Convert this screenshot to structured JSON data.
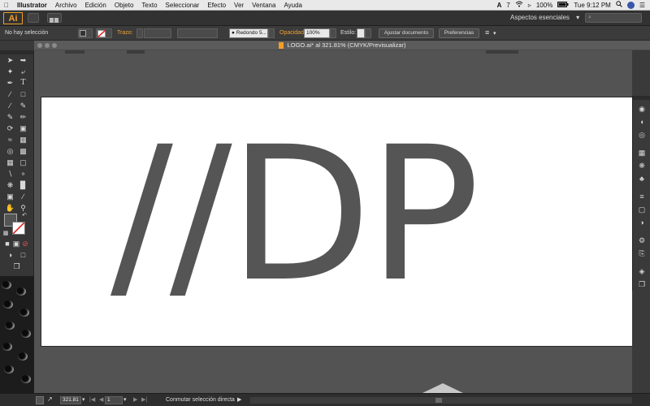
{
  "menubar": {
    "apple_icon": "apple-logo",
    "app_name": "Illustrator",
    "items": [
      "Archivo",
      "Edición",
      "Objeto",
      "Texto",
      "Seleccionar",
      "Efecto",
      "Ver",
      "Ventana",
      "Ayuda"
    ],
    "adobe_badge": "7",
    "battery": "100%",
    "clock": "Tue 9:12 PM"
  },
  "appbar": {
    "logo": "Ai",
    "workspace": "Aspectos esenciales",
    "workspace_caret": "▾",
    "search_placeholder": "⌕"
  },
  "controlbar": {
    "selection_status": "No hay selección",
    "stroke_label": "Trazo:",
    "brush_value": "Redondo 5...",
    "opacity_label": "Opacidad:",
    "opacity_value": "100%",
    "style_label": "Estilo:",
    "adjust_document": "Ajustar documento",
    "preferences": "Preferencias"
  },
  "document": {
    "title": "LOGO.ai* al 321.81% (CMYK/Previsualizar)",
    "artwork_text": "//DP"
  },
  "statusbar": {
    "zoom": "321.81",
    "artboard": "1",
    "tool_hint": "Conmutar selección directa"
  },
  "colors": {
    "accent": "#f29e28",
    "artwork": "#555555",
    "canvas": "#535353"
  }
}
